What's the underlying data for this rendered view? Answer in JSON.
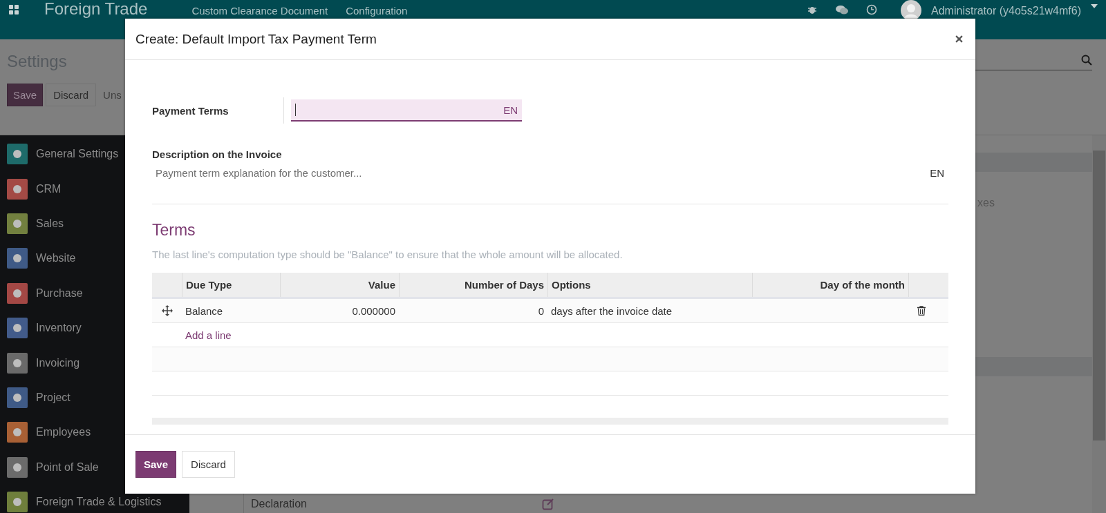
{
  "navbar": {
    "app_title": "Foreign Trade",
    "menus": [
      "Custom Clearance Document",
      "Configuration"
    ],
    "user": "Administrator (y4o5s21w4mf6)"
  },
  "control_panel": {
    "title": "Settings",
    "buttons": [
      "Save",
      "Discard"
    ],
    "status": "Uns"
  },
  "sidebar": {
    "items": [
      {
        "label": "General Settings",
        "color": "#1e6b6a"
      },
      {
        "label": "CRM",
        "color": "#a34a45"
      },
      {
        "label": "Sales",
        "color": "#72803f"
      },
      {
        "label": "Website",
        "color": "#3f5a86"
      },
      {
        "label": "Purchase",
        "color": "#a44845"
      },
      {
        "label": "Inventory",
        "color": "#425b8a"
      },
      {
        "label": "Invoicing",
        "color": "#6a6a6a"
      },
      {
        "label": "Project",
        "color": "#3f5a86"
      },
      {
        "label": "Employees",
        "color": "#a86035"
      },
      {
        "label": "Point of Sale",
        "color": "#6b6b6b"
      },
      {
        "label": "Foreign Trade & Logistics",
        "color": "#6f7f3c"
      }
    ]
  },
  "settings_page": {
    "text_1": "xes",
    "text_2": "Declaration"
  },
  "dialog": {
    "title": "Create: Default Import Tax Payment Term",
    "payment_terms": {
      "label": "Payment Terms",
      "lang": "EN",
      "focused": true
    },
    "description": {
      "label": "Description on the Invoice",
      "placeholder": "Payment term explanation for the customer...",
      "lang": "EN"
    },
    "terms": {
      "heading": "Terms",
      "note": "The last line's computation type should be \"Balance\" to ensure that the whole amount will be allocated.",
      "columns": [
        "Due Type",
        "Value",
        "Number of Days",
        "Options",
        "Day of the month"
      ],
      "rows": [
        {
          "due_type": "Balance",
          "value": "0.000000",
          "number_of_days": "0",
          "options": "days after the invoice date"
        }
      ],
      "add_line": "Add a line"
    },
    "buttons": [
      "Save",
      "Discard"
    ]
  }
}
